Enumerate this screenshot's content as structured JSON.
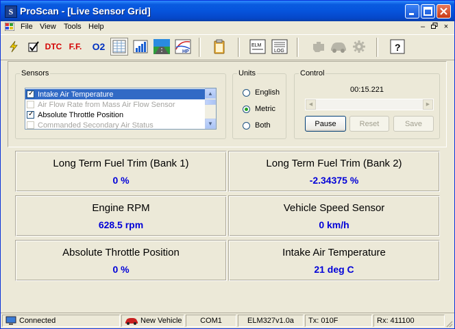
{
  "window": {
    "title": "ProScan - [Live Sensor Grid]",
    "app_icon_letter": "S"
  },
  "menu": {
    "items": [
      "File",
      "View",
      "Tools",
      "Help"
    ]
  },
  "toolbar": {
    "dtc_label": "DTC",
    "ff_label": "F.F.",
    "o2_label": "O2",
    "hp_label": "HP",
    "elm_label": "ELM",
    "log_label": "LOG",
    "help_label": "?"
  },
  "sensors": {
    "group_title": "Sensors",
    "items": [
      {
        "label": "Intake Air Temperature",
        "checked": true,
        "enabled": true,
        "selected": true
      },
      {
        "label": "Air Flow Rate from Mass Air Flow Sensor",
        "checked": false,
        "enabled": false,
        "selected": false
      },
      {
        "label": "Absolute Throttle Position",
        "checked": true,
        "enabled": true,
        "selected": false
      },
      {
        "label": "Commanded Secondary Air Status",
        "checked": false,
        "enabled": false,
        "selected": false
      }
    ]
  },
  "units": {
    "group_title": "Units",
    "options": [
      "English",
      "Metric",
      "Both"
    ],
    "selected": "Metric"
  },
  "control": {
    "group_title": "Control",
    "elapsed": "00:15.221",
    "pause_label": "Pause",
    "reset_label": "Reset",
    "save_label": "Save"
  },
  "tiles": [
    {
      "name": "Long Term Fuel Trim (Bank 1)",
      "value": "0 %"
    },
    {
      "name": "Long Term Fuel Trim (Bank 2)",
      "value": "-2.34375 %"
    },
    {
      "name": "Engine RPM",
      "value": "628.5 rpm"
    },
    {
      "name": "Vehicle Speed Sensor",
      "value": "0 km/h"
    },
    {
      "name": "Absolute Throttle Position",
      "value": "0 %"
    },
    {
      "name": "Intake Air Temperature",
      "value": "21 deg C"
    }
  ],
  "status": {
    "connection": "Connected",
    "vehicle": "New Vehicle",
    "port": "COM1",
    "interface": "ELM327v1.0a",
    "tx": "Tx: 010F",
    "rx": "Rx: 411100"
  },
  "colors": {
    "value_text": "#0000D8",
    "title_bar": "#0654DC",
    "selection": "#316AC5"
  }
}
